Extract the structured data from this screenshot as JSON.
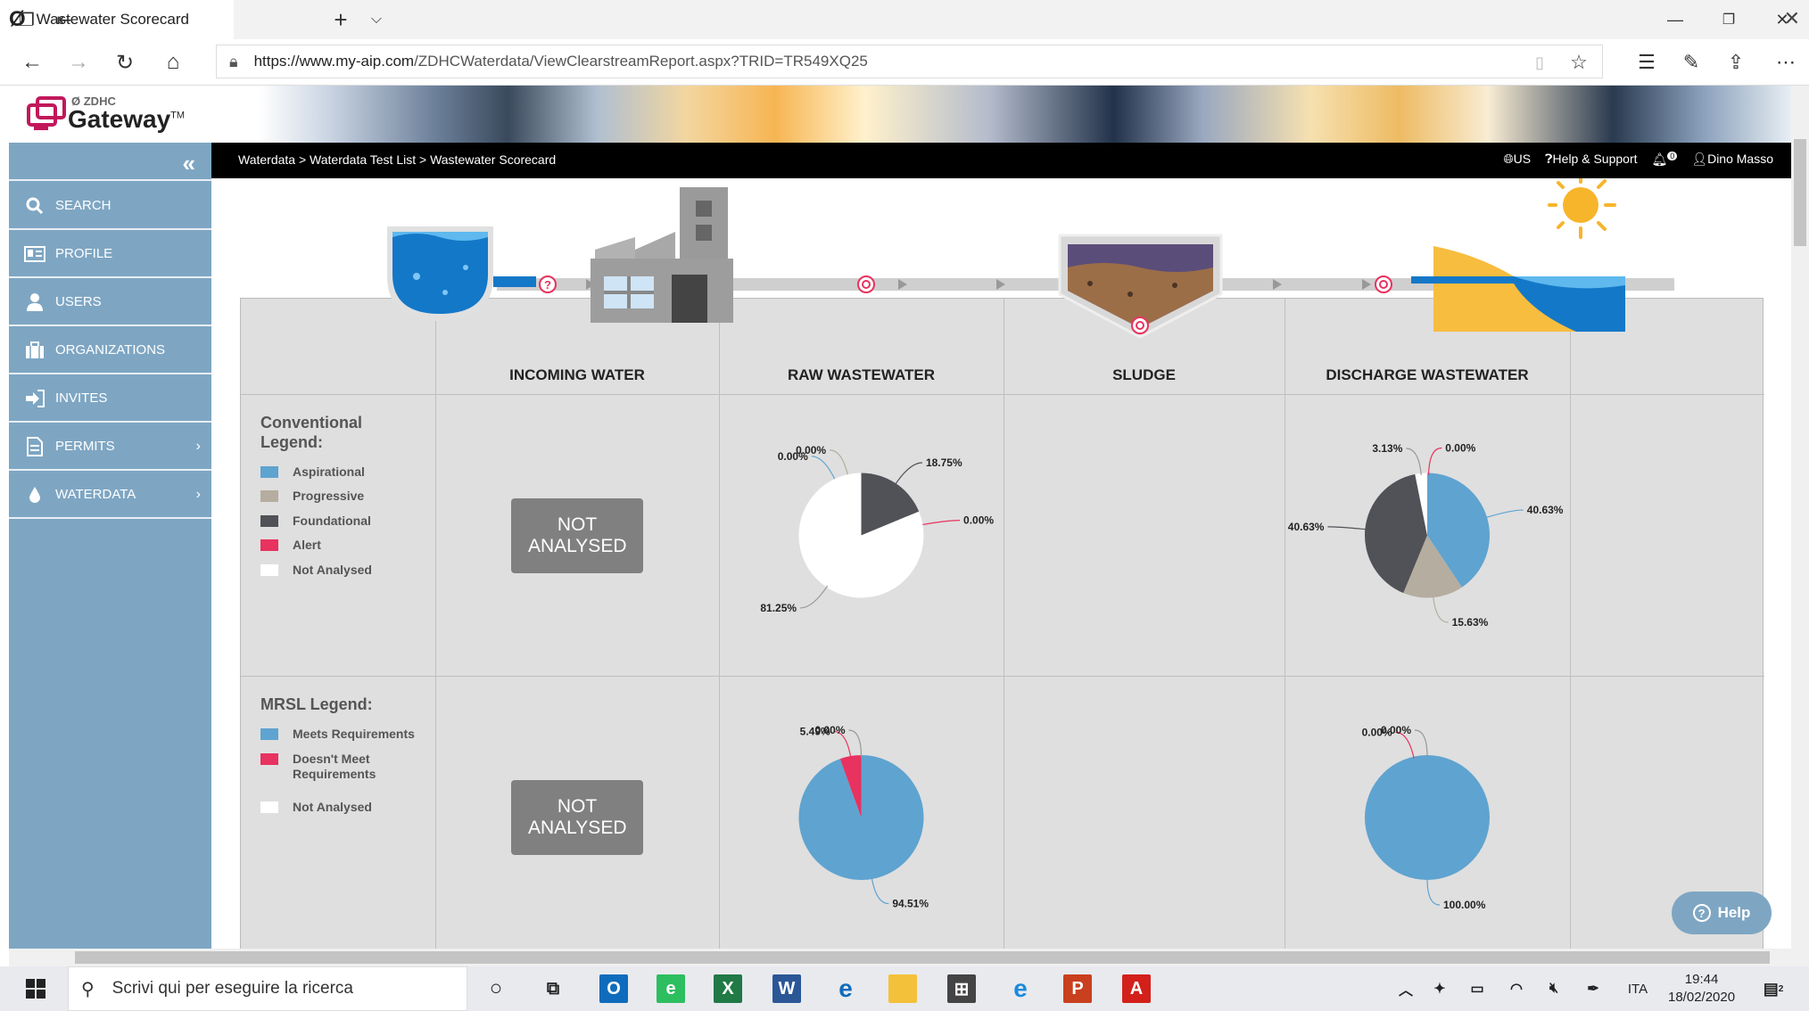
{
  "browser": {
    "tab_title": "Wastewater Scorecard",
    "url_domain": "https://www.my-aip.com",
    "url_path": "/ZDHCWaterdata/ViewClearstreamReport.aspx?TRID=TR549XQ25"
  },
  "site": {
    "logo_small": "ZDHC",
    "logo_main": "Gateway",
    "logo_tm": "TM"
  },
  "sidebar": {
    "items": [
      {
        "label": "SEARCH",
        "icon": "search-icon"
      },
      {
        "label": "PROFILE",
        "icon": "profile-card-icon"
      },
      {
        "label": "USERS",
        "icon": "user-icon"
      },
      {
        "label": "ORGANIZATIONS",
        "icon": "briefcase-icon"
      },
      {
        "label": "INVITES",
        "icon": "sign-in-icon"
      },
      {
        "label": "PERMITS",
        "icon": "document-icon"
      },
      {
        "label": "WATERDATA",
        "icon": "water-drop-icon"
      }
    ]
  },
  "topbar": {
    "breadcrumb": [
      "Waterdata",
      "Waterdata Test List",
      "Wastewater Scorecard"
    ],
    "region": "US",
    "help_support": "Help & Support",
    "notification_count": "0",
    "user_name": "Dino Masso"
  },
  "columns": [
    "INCOMING WATER",
    "RAW WASTEWATER",
    "SLUDGE",
    "DISCHARGE WASTEWATER"
  ],
  "conventional_legend": {
    "title": "Conventional Legend:",
    "items": [
      {
        "label": "Aspirational",
        "color": "#5fa3d0"
      },
      {
        "label": "Progressive",
        "color": "#b5ada0"
      },
      {
        "label": "Foundational",
        "color": "#505257"
      },
      {
        "label": "Alert",
        "color": "#e8325f"
      },
      {
        "label": "Not Analysed",
        "color": "#ffffff"
      }
    ]
  },
  "mrsl_legend": {
    "title": "MRSL Legend:",
    "items": [
      {
        "label": "Meets Requirements",
        "color": "#5fa3d0"
      },
      {
        "label": "Doesn't Meet Requirements",
        "color": "#e8325f"
      },
      {
        "label": "Not Analysed",
        "color": "#ffffff"
      }
    ]
  },
  "not_analysed_label": "NOT ANALYSED",
  "chart_data": [
    {
      "type": "pie",
      "name": "Conventional - Raw Wastewater",
      "categories": [
        "Aspirational",
        "Progressive",
        "Foundational",
        "Alert",
        "Not Analysed"
      ],
      "values": [
        0.0,
        0.0,
        18.75,
        0.0,
        81.25
      ],
      "labels": [
        "0.00%",
        "0.00%",
        "18.75%",
        "0.00%",
        "81.25%"
      ]
    },
    {
      "type": "pie",
      "name": "Conventional - Discharge Wastewater",
      "categories": [
        "Aspirational",
        "Progressive",
        "Foundational",
        "Alert",
        "Not Analysed"
      ],
      "values": [
        40.63,
        15.63,
        40.63,
        0.0,
        3.13
      ],
      "labels": [
        "40.63%",
        "15.63%",
        "40.63%",
        "0.00%",
        "3.13%"
      ]
    },
    {
      "type": "pie",
      "name": "MRSL - Raw Wastewater",
      "categories": [
        "Meets Requirements",
        "Doesn't Meet Requirements",
        "Not Analysed"
      ],
      "values": [
        94.51,
        5.49,
        0.0
      ],
      "labels": [
        "94.51%",
        "5.49%",
        "0.00%"
      ]
    },
    {
      "type": "pie",
      "name": "MRSL - Discharge Wastewater",
      "categories": [
        "Meets Requirements",
        "Doesn't Meet Requirements",
        "Not Analysed"
      ],
      "values": [
        100.0,
        0.0,
        0.0
      ],
      "labels": [
        "100.00%",
        "0.00%",
        "0.00%"
      ]
    }
  ],
  "help_button": "Help",
  "taskbar": {
    "search_placeholder": "Scrivi qui per eseguire la ricerca",
    "language": "ITA",
    "time": "19:44",
    "date": "18/02/2020",
    "notification_badge": "2"
  }
}
